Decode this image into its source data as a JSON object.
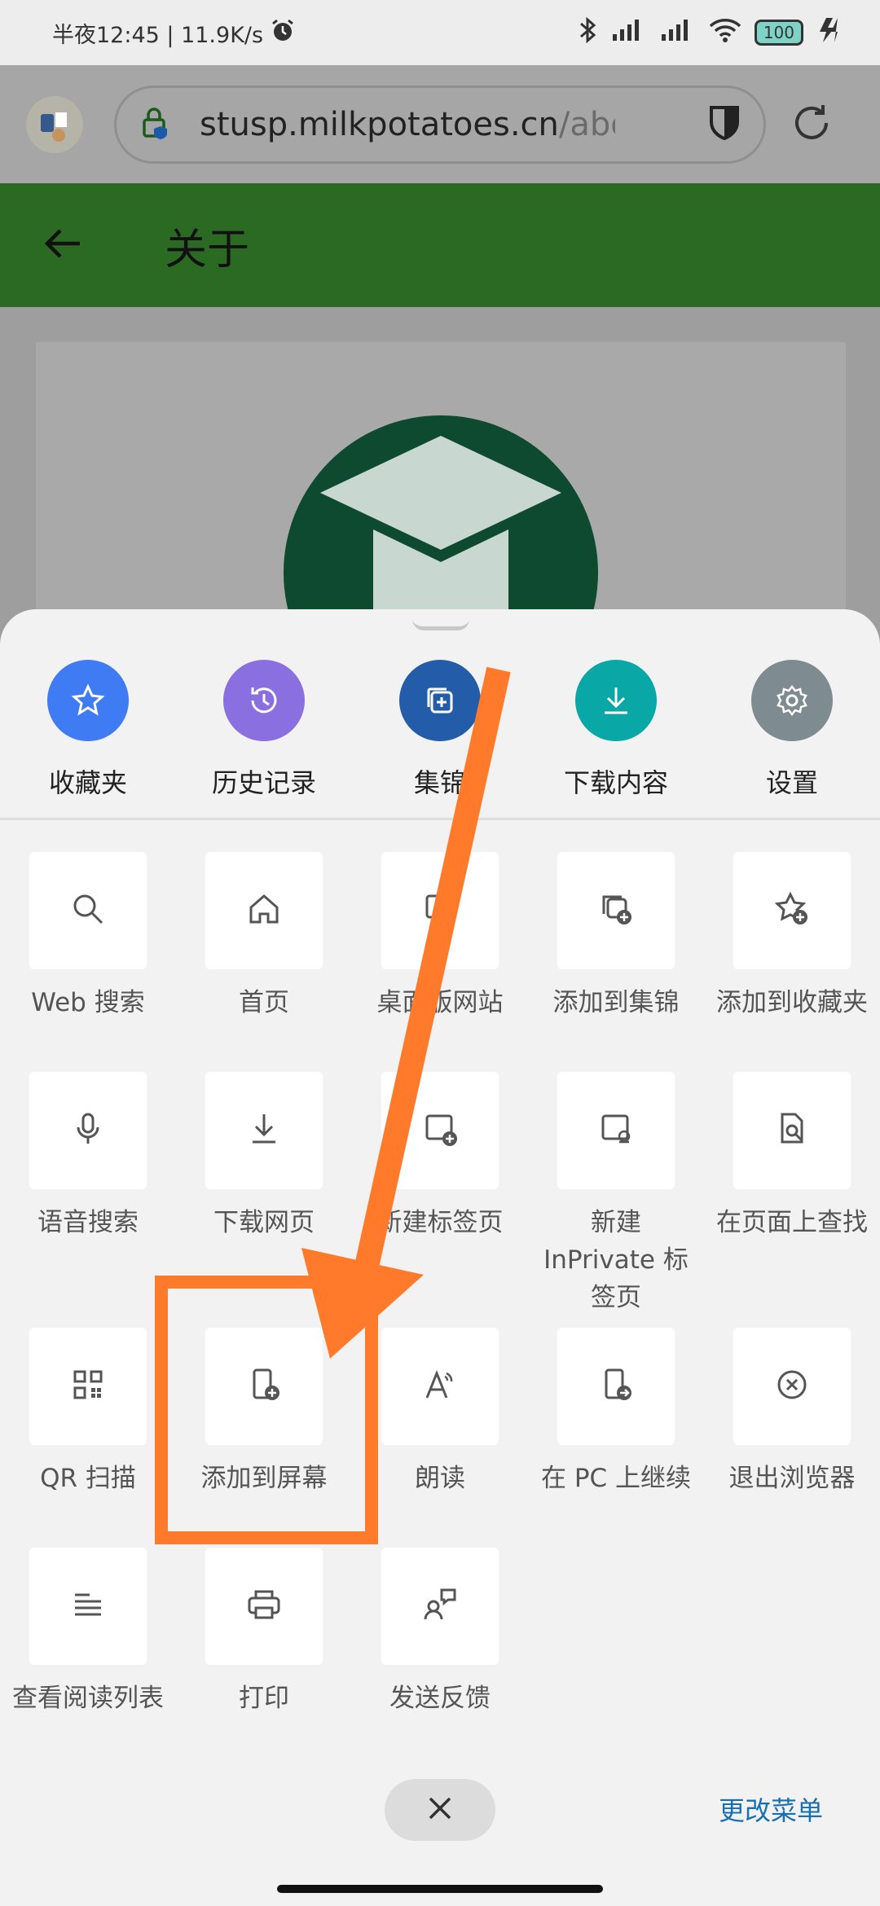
{
  "status_bar": {
    "time_speed": "半夜12:45 | 11.9K/s",
    "battery": "100"
  },
  "browser": {
    "url_main": "stusp.milkpotatoes.cn",
    "url_dim": "/abou"
  },
  "app_header": {
    "title": "关于"
  },
  "quick_actions": [
    {
      "label": "收藏夹",
      "color": "#3f7cf4",
      "icon": "star-icon"
    },
    {
      "label": "历史记录",
      "color": "#8a6fe0",
      "icon": "history-icon"
    },
    {
      "label": "集锦",
      "color": "#235ca8",
      "icon": "collections-icon"
    },
    {
      "label": "下载内容",
      "color": "#0aa7a7",
      "icon": "download-icon"
    },
    {
      "label": "设置",
      "color": "#7e8b90",
      "icon": "gear-icon"
    }
  ],
  "menu_items": [
    {
      "label": "Web 搜索",
      "icon": "search-icon"
    },
    {
      "label": "首页",
      "icon": "home-icon"
    },
    {
      "label": "桌面版网站",
      "icon": "desktop-site-icon"
    },
    {
      "label": "添加到集锦",
      "icon": "add-collection-icon"
    },
    {
      "label": "添加到收藏夹",
      "icon": "add-favorite-icon"
    },
    {
      "label": "语音搜索",
      "icon": "microphone-icon"
    },
    {
      "label": "下载网页",
      "icon": "download-page-icon"
    },
    {
      "label": "新建标签页",
      "icon": "new-tab-icon"
    },
    {
      "label": "新建 InPrivate 标签页",
      "icon": "inprivate-tab-icon"
    },
    {
      "label": "在页面上查找",
      "icon": "find-in-page-icon"
    },
    {
      "label": "QR 扫描",
      "icon": "qr-icon"
    },
    {
      "label": "添加到屏幕",
      "icon": "add-to-screen-icon"
    },
    {
      "label": "朗读",
      "icon": "read-aloud-icon"
    },
    {
      "label": "在 PC 上继续",
      "icon": "continue-on-pc-icon"
    },
    {
      "label": "退出浏览器",
      "icon": "exit-icon"
    },
    {
      "label": "查看阅读列表",
      "icon": "reading-list-icon"
    },
    {
      "label": "打印",
      "icon": "print-icon"
    },
    {
      "label": "发送反馈",
      "icon": "feedback-icon"
    }
  ],
  "footer": {
    "change_menu": "更改菜单"
  },
  "colors": {
    "annotation": "#ff7a2a",
    "link": "#1a6fb0"
  }
}
